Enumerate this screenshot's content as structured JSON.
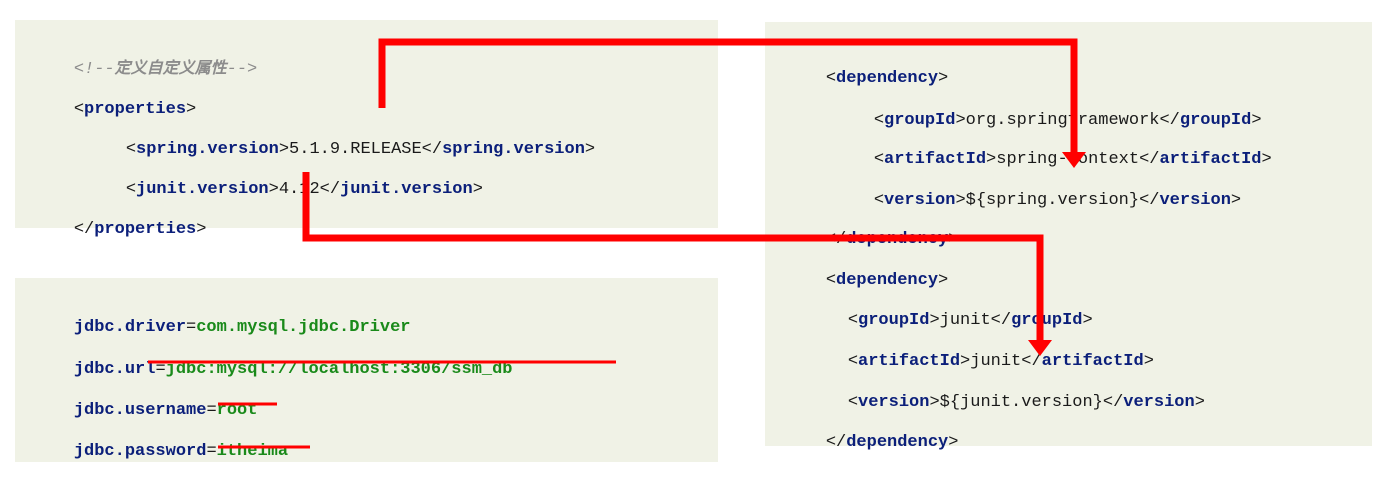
{
  "colors": {
    "panel_bg": "#f0f2e6",
    "tag": "#0b1f7a",
    "value": "#1a8a1a",
    "comment": "#8c8c8c",
    "annotation": "#ff0000"
  },
  "props_panel": {
    "comment_open": "<!--",
    "comment_text": "定义自定义属性",
    "comment_close": "-->",
    "lt": "<",
    "gt": ">",
    "lt_slash": "</",
    "tag_properties": "properties",
    "tag_spring_version": "spring.version",
    "tag_junit_version": "junit.version",
    "spring_version_value": "5.1.9.RELEASE",
    "junit_version_value": "4.12"
  },
  "jdbc_panel": {
    "eq": "=",
    "lines": [
      {
        "key": "jdbc.driver",
        "value": "com.mysql.jdbc.Driver"
      },
      {
        "key": "jdbc.url",
        "value": "jdbc:mysql://localhost:3306/ssm_db"
      },
      {
        "key": "jdbc.username",
        "value": "root"
      },
      {
        "key": "jdbc.password",
        "value": "itheima"
      }
    ]
  },
  "deps_panel": {
    "lt": "<",
    "gt": ">",
    "lt_slash": "</",
    "tag_dependency": "dependency",
    "tag_groupId": "groupId",
    "tag_artifactId": "artifactId",
    "tag_version": "version",
    "dep1": {
      "groupId": "org.springframework",
      "artifactId": "spring-context",
      "version": "${spring.version}"
    },
    "dep2": {
      "groupId": "junit",
      "artifactId": "junit",
      "version": "${junit.version}"
    }
  }
}
